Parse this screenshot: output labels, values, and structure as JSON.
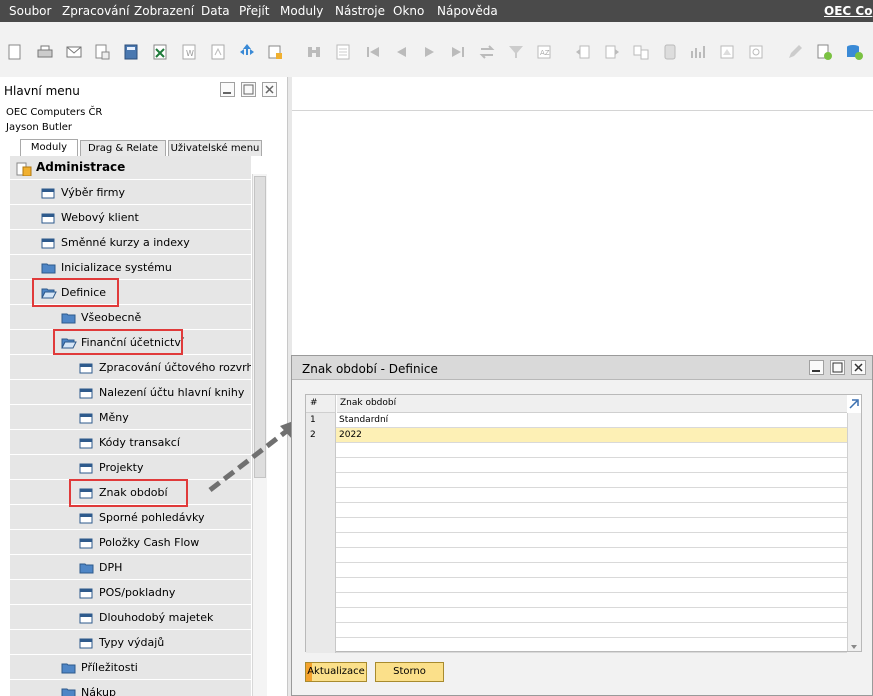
{
  "menubar": {
    "items": [
      "Soubor",
      "Zpracování",
      "Zobrazení",
      "Data",
      "Přejít",
      "Moduly",
      "Nástroje",
      "Okno",
      "Nápověda"
    ],
    "company": "OEC Co"
  },
  "toolbar": {
    "icons": [
      "new-icon",
      "print-icon",
      "email-icon",
      "print-preview-icon",
      "calculator-icon",
      "excel-icon",
      "word-icon",
      "pdf-icon",
      "move-icon",
      "lock-icon",
      "find-icon",
      "form-icon",
      "first-record-icon",
      "previous-record-icon",
      "next-record-icon",
      "last-record-icon",
      "refresh-icon",
      "filter-icon",
      "sort-icon",
      "base-document-icon",
      "target-document-icon",
      "relationship-map-icon",
      "journal-icon",
      "gross-profit-icon",
      "volume-icon",
      "payment-icon",
      "transaction-icon",
      "settings-icon",
      "edit-icon",
      "add-icon",
      "database-icon"
    ]
  },
  "main_menu": {
    "title": "Hlavní menu",
    "company": "OEC Computers ČR",
    "user": "Jayson Butler",
    "tabs": [
      "Moduly",
      "Drag & Relate",
      "Uživatelské menu"
    ],
    "tree": [
      {
        "label": "Administrace",
        "level": 0,
        "icon": "module-icon",
        "bold": true
      },
      {
        "label": "Výběr firmy",
        "level": 1,
        "icon": "window-icon"
      },
      {
        "label": "Webový klient",
        "level": 1,
        "icon": "window-icon"
      },
      {
        "label": "Směnné kurzy a indexy",
        "level": 1,
        "icon": "window-icon"
      },
      {
        "label": "Inicializace systému",
        "level": 1,
        "icon": "folder-icon"
      },
      {
        "label": "Definice",
        "level": 1,
        "icon": "open-folder-icon"
      },
      {
        "label": "Všeobecně",
        "level": 2,
        "icon": "folder-icon"
      },
      {
        "label": "Finanční účetnictví",
        "level": 2,
        "icon": "open-folder-icon"
      },
      {
        "label": "Zpracování účtového rozvrhu",
        "level": 3,
        "icon": "window-icon"
      },
      {
        "label": "Nalezení účtu hlavní knihy",
        "level": 3,
        "icon": "window-icon"
      },
      {
        "label": "Měny",
        "level": 3,
        "icon": "window-icon"
      },
      {
        "label": "Kódy transakcí",
        "level": 3,
        "icon": "window-icon"
      },
      {
        "label": "Projekty",
        "level": 3,
        "icon": "window-icon"
      },
      {
        "label": "Znak období",
        "level": 3,
        "icon": "window-icon"
      },
      {
        "label": "Sporné pohledávky",
        "level": 3,
        "icon": "window-icon"
      },
      {
        "label": "Položky Cash Flow",
        "level": 3,
        "icon": "window-icon"
      },
      {
        "label": "DPH",
        "level": 3,
        "icon": "folder-icon"
      },
      {
        "label": "POS/pokladny",
        "level": 3,
        "icon": "window-icon"
      },
      {
        "label": "Dlouhodobý majetek",
        "level": 3,
        "icon": "window-icon"
      },
      {
        "label": "Typy výdajů",
        "level": 3,
        "icon": "window-icon"
      },
      {
        "label": "Příležitosti",
        "level": 2,
        "icon": "folder-icon"
      },
      {
        "label": "Nákup",
        "level": 2,
        "icon": "folder-icon"
      }
    ]
  },
  "form": {
    "title": "Znak období - Definice",
    "columns": [
      "#",
      "Znak období"
    ],
    "rows": [
      {
        "num": "1",
        "value": "Standardní"
      },
      {
        "num": "2",
        "value": "2022"
      }
    ],
    "buttons": {
      "update": "Aktualizace",
      "cancel": "Storno"
    },
    "colors": {
      "selected_row": "#fdf0b5",
      "button": "#fbe08a",
      "button_accent": "#f3a22d",
      "highlight_box": "#e03a3a"
    }
  }
}
